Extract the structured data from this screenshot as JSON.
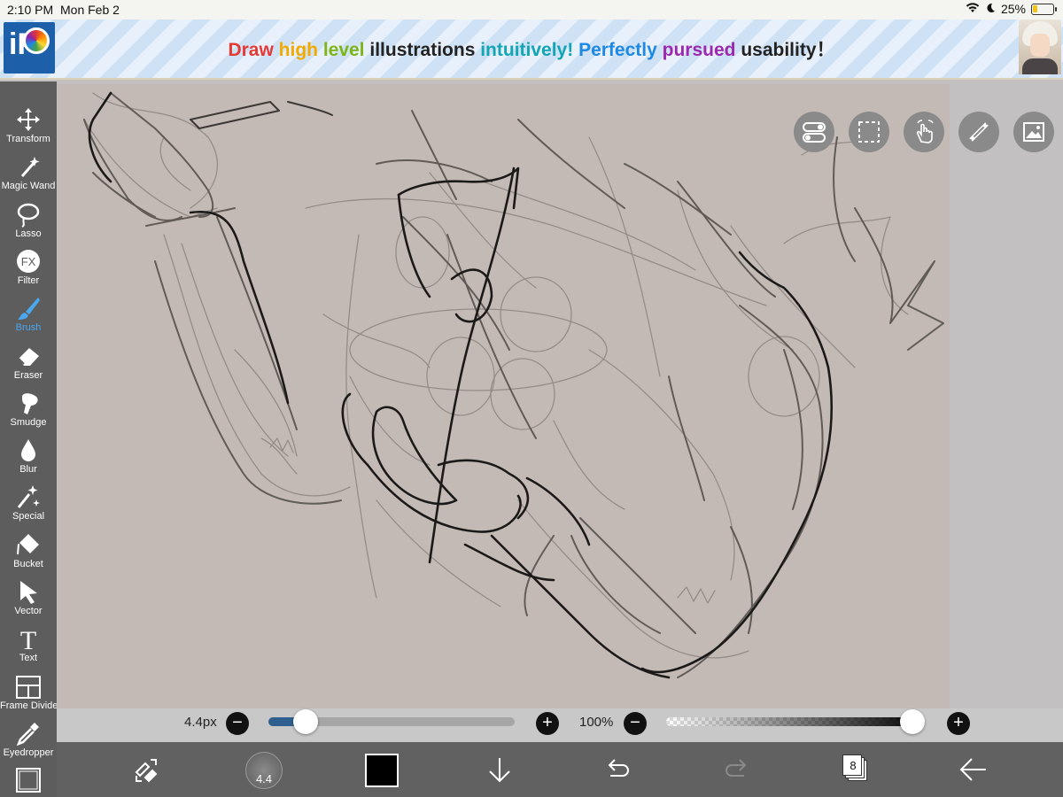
{
  "status_bar": {
    "time": "2:10 PM",
    "date": "Mon Feb 2",
    "battery_text": "25%",
    "battery_level": 0.25,
    "icons": [
      "wifi-icon",
      "moon-icon",
      "battery-icon"
    ]
  },
  "banner": {
    "logo_text": "iP",
    "slogan": [
      {
        "text": "Draw ",
        "color": "#e53935"
      },
      {
        "text": "high ",
        "color": "#f2a900"
      },
      {
        "text": "level ",
        "color": "#7cb518"
      },
      {
        "text": "illustrations ",
        "color": "#222222"
      },
      {
        "text": "intuitively! ",
        "color": "#12a5b5"
      },
      {
        "text": "Perfectly ",
        "color": "#1e88e5"
      },
      {
        "text": "pursued ",
        "color": "#9c27b0"
      },
      {
        "text": "usability",
        "color": "#222222"
      },
      {
        "text": "！",
        "color": "#222222"
      }
    ]
  },
  "tools": [
    {
      "label": "Transform",
      "icon": "move-icon",
      "active": false
    },
    {
      "label": "Magic Wand",
      "icon": "magic-wand-icon",
      "active": false
    },
    {
      "label": "Lasso",
      "icon": "lasso-icon",
      "active": false
    },
    {
      "label": "Filter",
      "icon": "fx-icon",
      "active": false
    },
    {
      "label": "Brush",
      "icon": "brush-icon",
      "active": true
    },
    {
      "label": "Eraser",
      "icon": "eraser-icon",
      "active": false
    },
    {
      "label": "Smudge",
      "icon": "smudge-icon",
      "active": false
    },
    {
      "label": "Blur",
      "icon": "drop-icon",
      "active": false
    },
    {
      "label": "Special",
      "icon": "sparkle-icon",
      "active": false
    },
    {
      "label": "Bucket",
      "icon": "bucket-icon",
      "active": false
    },
    {
      "label": "Vector",
      "icon": "cursor-icon",
      "active": false
    },
    {
      "label": "Text",
      "icon": "text-icon",
      "active": false
    },
    {
      "label": "Frame Divider",
      "icon": "frame-divider-icon",
      "active": false
    },
    {
      "label": "Eyedropper",
      "icon": "eyedropper-icon",
      "active": false
    },
    {
      "label": "",
      "icon": "canvas-icon",
      "active": false
    }
  ],
  "float_buttons": [
    "toggle-icon",
    "selection-icon",
    "touch-icon",
    "ruler-icon",
    "image-icon"
  ],
  "sliders": {
    "size_label": "4.4px",
    "size_fraction": 0.1,
    "opacity_label": "100%",
    "opacity_fraction": 1.0,
    "minus": "−",
    "plus": "+"
  },
  "bottom_bar": {
    "brush_size": "4.4",
    "color": "#000000",
    "layer_count": "8"
  },
  "colors": {
    "accent": "#4aa8f0",
    "toolbar_bg": "#5d5d5d",
    "canvas_bg": "#c4bab5"
  }
}
